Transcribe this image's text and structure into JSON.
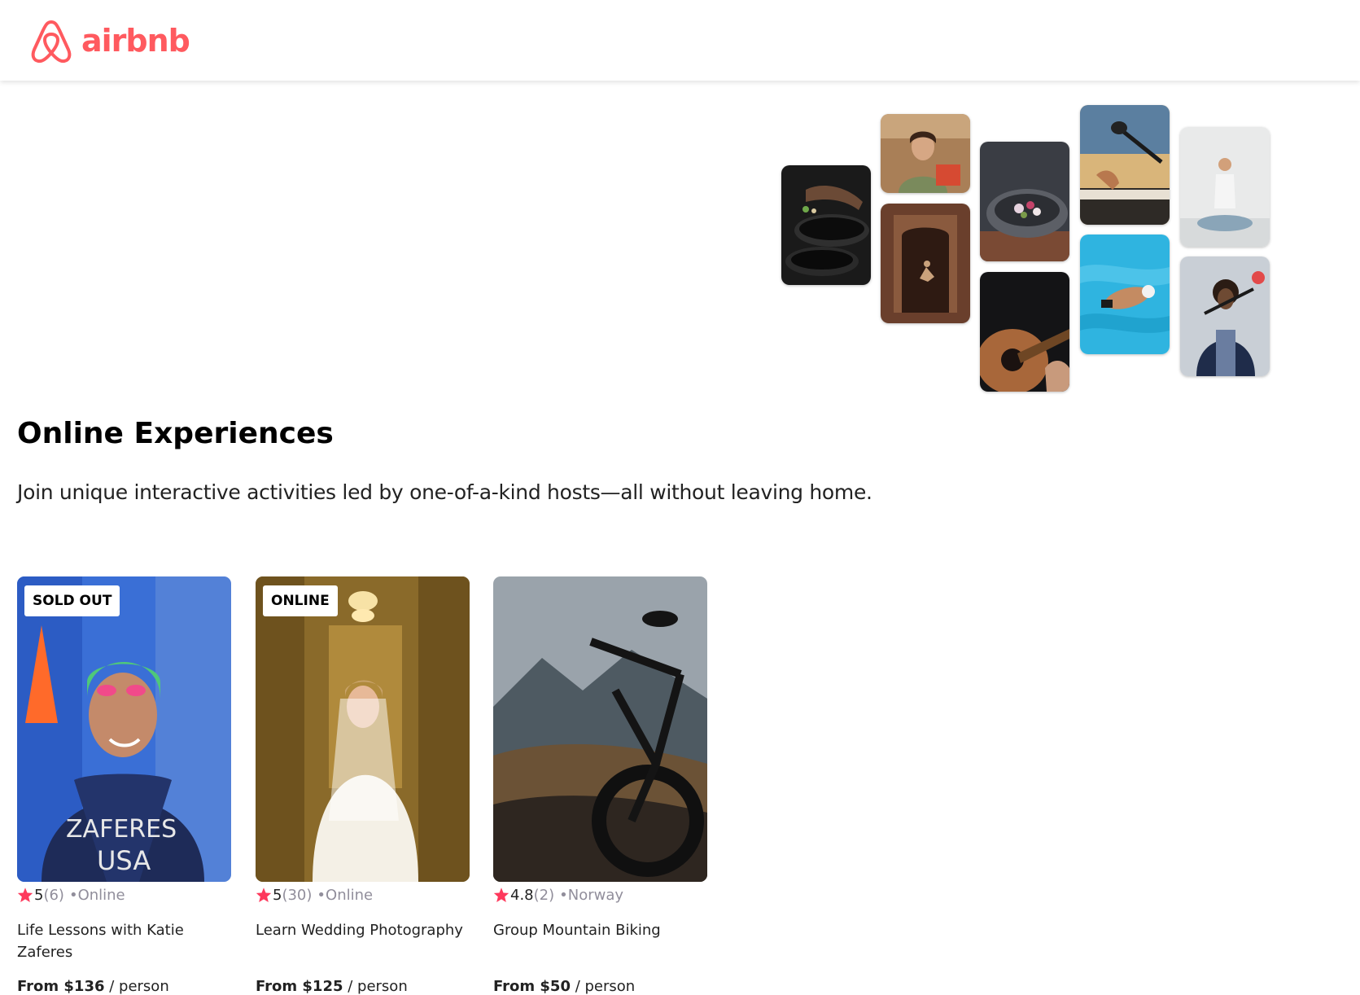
{
  "brand": {
    "name": "airbnb",
    "color": "#FF5A5F",
    "icon": "airbnb-logo-icon"
  },
  "hero": {
    "title": "Online Experiences",
    "subtitle": "Join unique interactive activities led by one-of-a-kind hosts—all without leaving home."
  },
  "cards": [
    {
      "badge": "SOLD OUT",
      "rating": "5",
      "review_count": "(6)",
      "location": "•Online",
      "title": "Life Lessons with Katie Zaferes",
      "price_label": "From $136",
      "price_unit": " / person"
    },
    {
      "badge": "ONLINE",
      "rating": "5",
      "review_count": "(30)",
      "location": "•Online",
      "title": "Learn Wedding Photography",
      "price_label": "From $125",
      "price_unit": " / person"
    },
    {
      "badge": "",
      "rating": "4.8",
      "review_count": "(2)",
      "location": "•Norway",
      "title": "Group Mountain Biking",
      "price_label": "From $50",
      "price_unit": " / person"
    }
  ],
  "colors": {
    "star": "#FE395C",
    "muted_text": "#918E9B"
  }
}
